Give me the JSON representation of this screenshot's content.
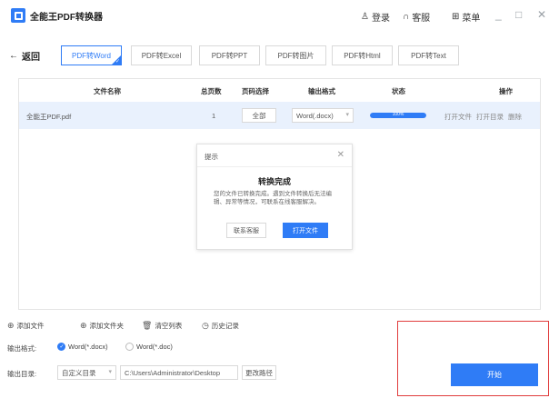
{
  "app": {
    "title": "全能王PDF转换器",
    "accent_color": "#2f7cf6",
    "login": "登录",
    "service": "客服",
    "menu": "菜单",
    "minimize": "_",
    "maximize": "□",
    "close": "✕"
  },
  "nav": {
    "back": "返回",
    "tabs": [
      {
        "label": "PDF转Word",
        "active": true
      },
      {
        "label": "PDF转Excel",
        "active": false
      },
      {
        "label": "PDF转PPT",
        "active": false
      },
      {
        "label": "PDF转图片",
        "active": false
      },
      {
        "label": "PDF转Html",
        "active": false
      },
      {
        "label": "PDF转Text",
        "active": false
      }
    ]
  },
  "table": {
    "headers": [
      "文件名称",
      "总页数",
      "页码选择",
      "输出格式",
      "状态",
      "操作"
    ],
    "rows": [
      {
        "file_name": "全能王PDF.pdf",
        "total_pages": "1",
        "page_select": "全部",
        "output_format": "Word(.docx)",
        "progress_percent": 100,
        "progress_text": "100%",
        "actions": [
          "打开文件",
          "打开目录",
          "删除"
        ]
      }
    ]
  },
  "dialog": {
    "title": "提示",
    "close": "✕",
    "heading": "转换完成",
    "message": "您的文件已转换完成。遇到文件转换后无法编辑、异常等情况，可联系在线客服解决。",
    "contact_button": "联系客服",
    "open_button": "打开文件"
  },
  "bottom": {
    "add_file": "添加文件",
    "add_folder": "添加文件夹",
    "clear_list": "清空列表",
    "history": "历史记录",
    "format_label": "输出格式:",
    "format_options": [
      {
        "label": "Word(*.docx)",
        "checked": true
      },
      {
        "label": "Word(*.doc)",
        "checked": false
      }
    ],
    "dir_label": "输出目录:",
    "dir_select": "自定义目录",
    "dir_path": "C:\\Users\\Administrator\\Desktop",
    "change_path": "更改路径",
    "start": "开始"
  }
}
